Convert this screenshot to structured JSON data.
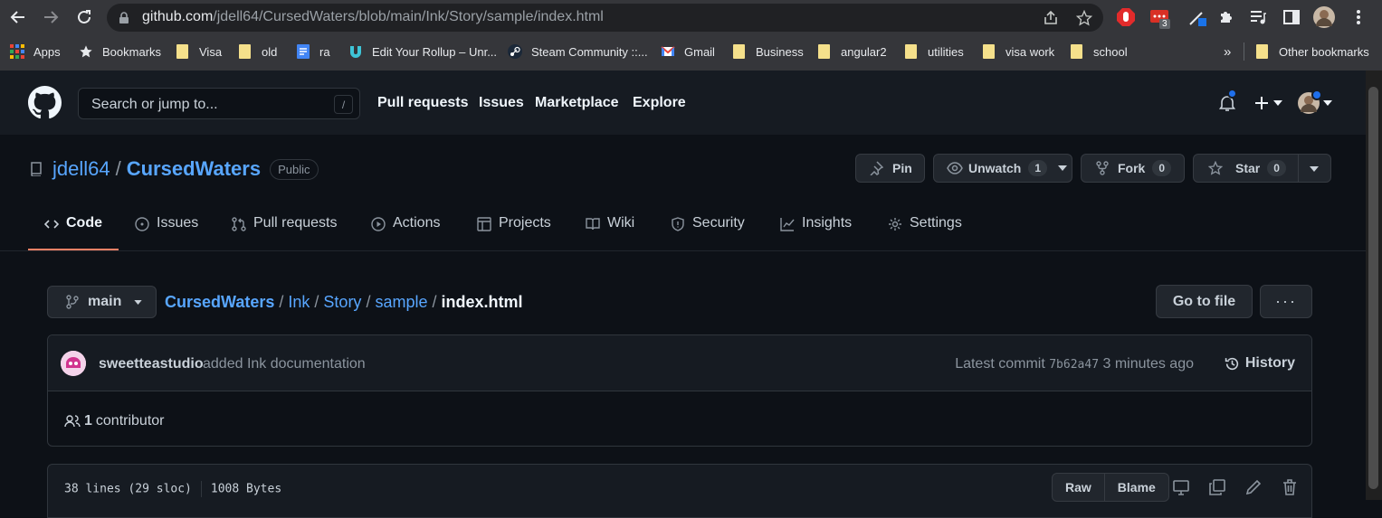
{
  "browser": {
    "url_host": "github.com",
    "url_path": "/jdell64/CursedWaters/blob/main/Ink/Story/sample/index.html",
    "ext_badge": "3",
    "bookmarks": [
      {
        "label": "Apps",
        "icon": "apps-grid-icon"
      },
      {
        "label": "Bookmarks",
        "icon": "star-icon"
      },
      {
        "label": "Visa",
        "icon": "folder-icon"
      },
      {
        "label": "old",
        "icon": "folder-icon"
      },
      {
        "label": "ra",
        "icon": "docs-icon"
      },
      {
        "label": "Edit Your Rollup – Unr...",
        "icon": "rollup-icon"
      },
      {
        "label": "Steam Community ::...",
        "icon": "steam-icon"
      },
      {
        "label": "Gmail",
        "icon": "gmail-icon"
      },
      {
        "label": "Business",
        "icon": "folder-icon"
      },
      {
        "label": "angular2",
        "icon": "folder-icon"
      },
      {
        "label": "utilities",
        "icon": "folder-icon"
      },
      {
        "label": "visa work",
        "icon": "folder-icon"
      },
      {
        "label": "school",
        "icon": "folder-icon"
      }
    ],
    "overflow": "»",
    "other_bookmarks": "Other bookmarks"
  },
  "github": {
    "search_placeholder": "Search or jump to...",
    "search_key": "/",
    "nav": [
      "Pull requests",
      "Issues",
      "Marketplace",
      "Explore"
    ]
  },
  "repo": {
    "owner": "jdell64",
    "separator": "/",
    "name": "CursedWaters",
    "visibility": "Public",
    "pin": "Pin",
    "unwatch": "Unwatch",
    "watch_count": "1",
    "fork": "Fork",
    "fork_count": "0",
    "star": "Star",
    "star_count": "0",
    "tabs": [
      "Code",
      "Issues",
      "Pull requests",
      "Actions",
      "Projects",
      "Wiki",
      "Security",
      "Insights",
      "Settings"
    ]
  },
  "file": {
    "branch": "main",
    "path": [
      "CursedWaters",
      "Ink",
      "Story",
      "sample"
    ],
    "current": "index.html",
    "go_to_file": "Go to file",
    "more": "···",
    "commit_author": "sweetteastudio",
    "commit_message": "added Ink documentation",
    "latest_commit_label": "Latest commit",
    "commit_sha": "7b62a47",
    "commit_time": "3 minutes ago",
    "history": "History",
    "contributors_count": "1",
    "contributors_label": "contributor",
    "lines": "38 lines (29 sloc)",
    "size": "1008 Bytes",
    "raw": "Raw",
    "blame": "Blame"
  },
  "colors": {
    "link": "#58a6ff",
    "tab_underline": "#f78166",
    "notification_dot": "#1f6feb"
  }
}
